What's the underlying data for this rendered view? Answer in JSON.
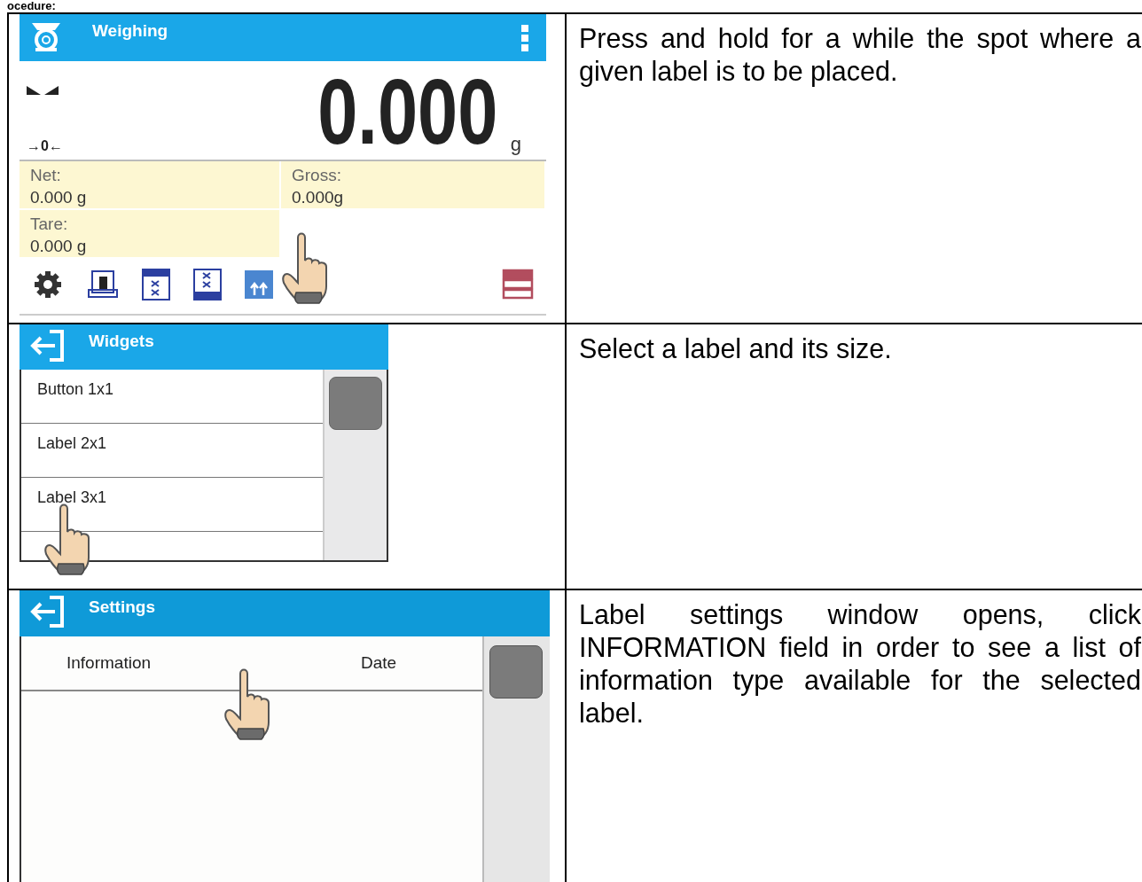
{
  "heading": "ocedure:",
  "steps": [
    {
      "screen": {
        "kind": "weighing",
        "title": "Weighing",
        "zero_mark": "→0←",
        "reading": "0.000",
        "unit": "g",
        "fields": [
          {
            "label": "Net:",
            "value": "0.000 g"
          },
          {
            "label": "Gross:",
            "value": "0.000g"
          },
          {
            "label": "Tare:",
            "value": "0.000 g"
          }
        ]
      },
      "instruction": "Press and hold for a while the spot where a given label is to be placed."
    },
    {
      "screen": {
        "kind": "list",
        "title": "Widgets",
        "items": [
          "Button 1x1",
          "Label 2x1",
          "Label 3x1"
        ]
      },
      "instruction": "Select a label and its size."
    },
    {
      "screen": {
        "kind": "settings",
        "title": "Settings",
        "rows": [
          {
            "label": "Information",
            "value": "Date"
          }
        ]
      },
      "instruction": "Label settings window opens, click INFORMATION field in order to see a list of information type available for the selected label."
    }
  ]
}
